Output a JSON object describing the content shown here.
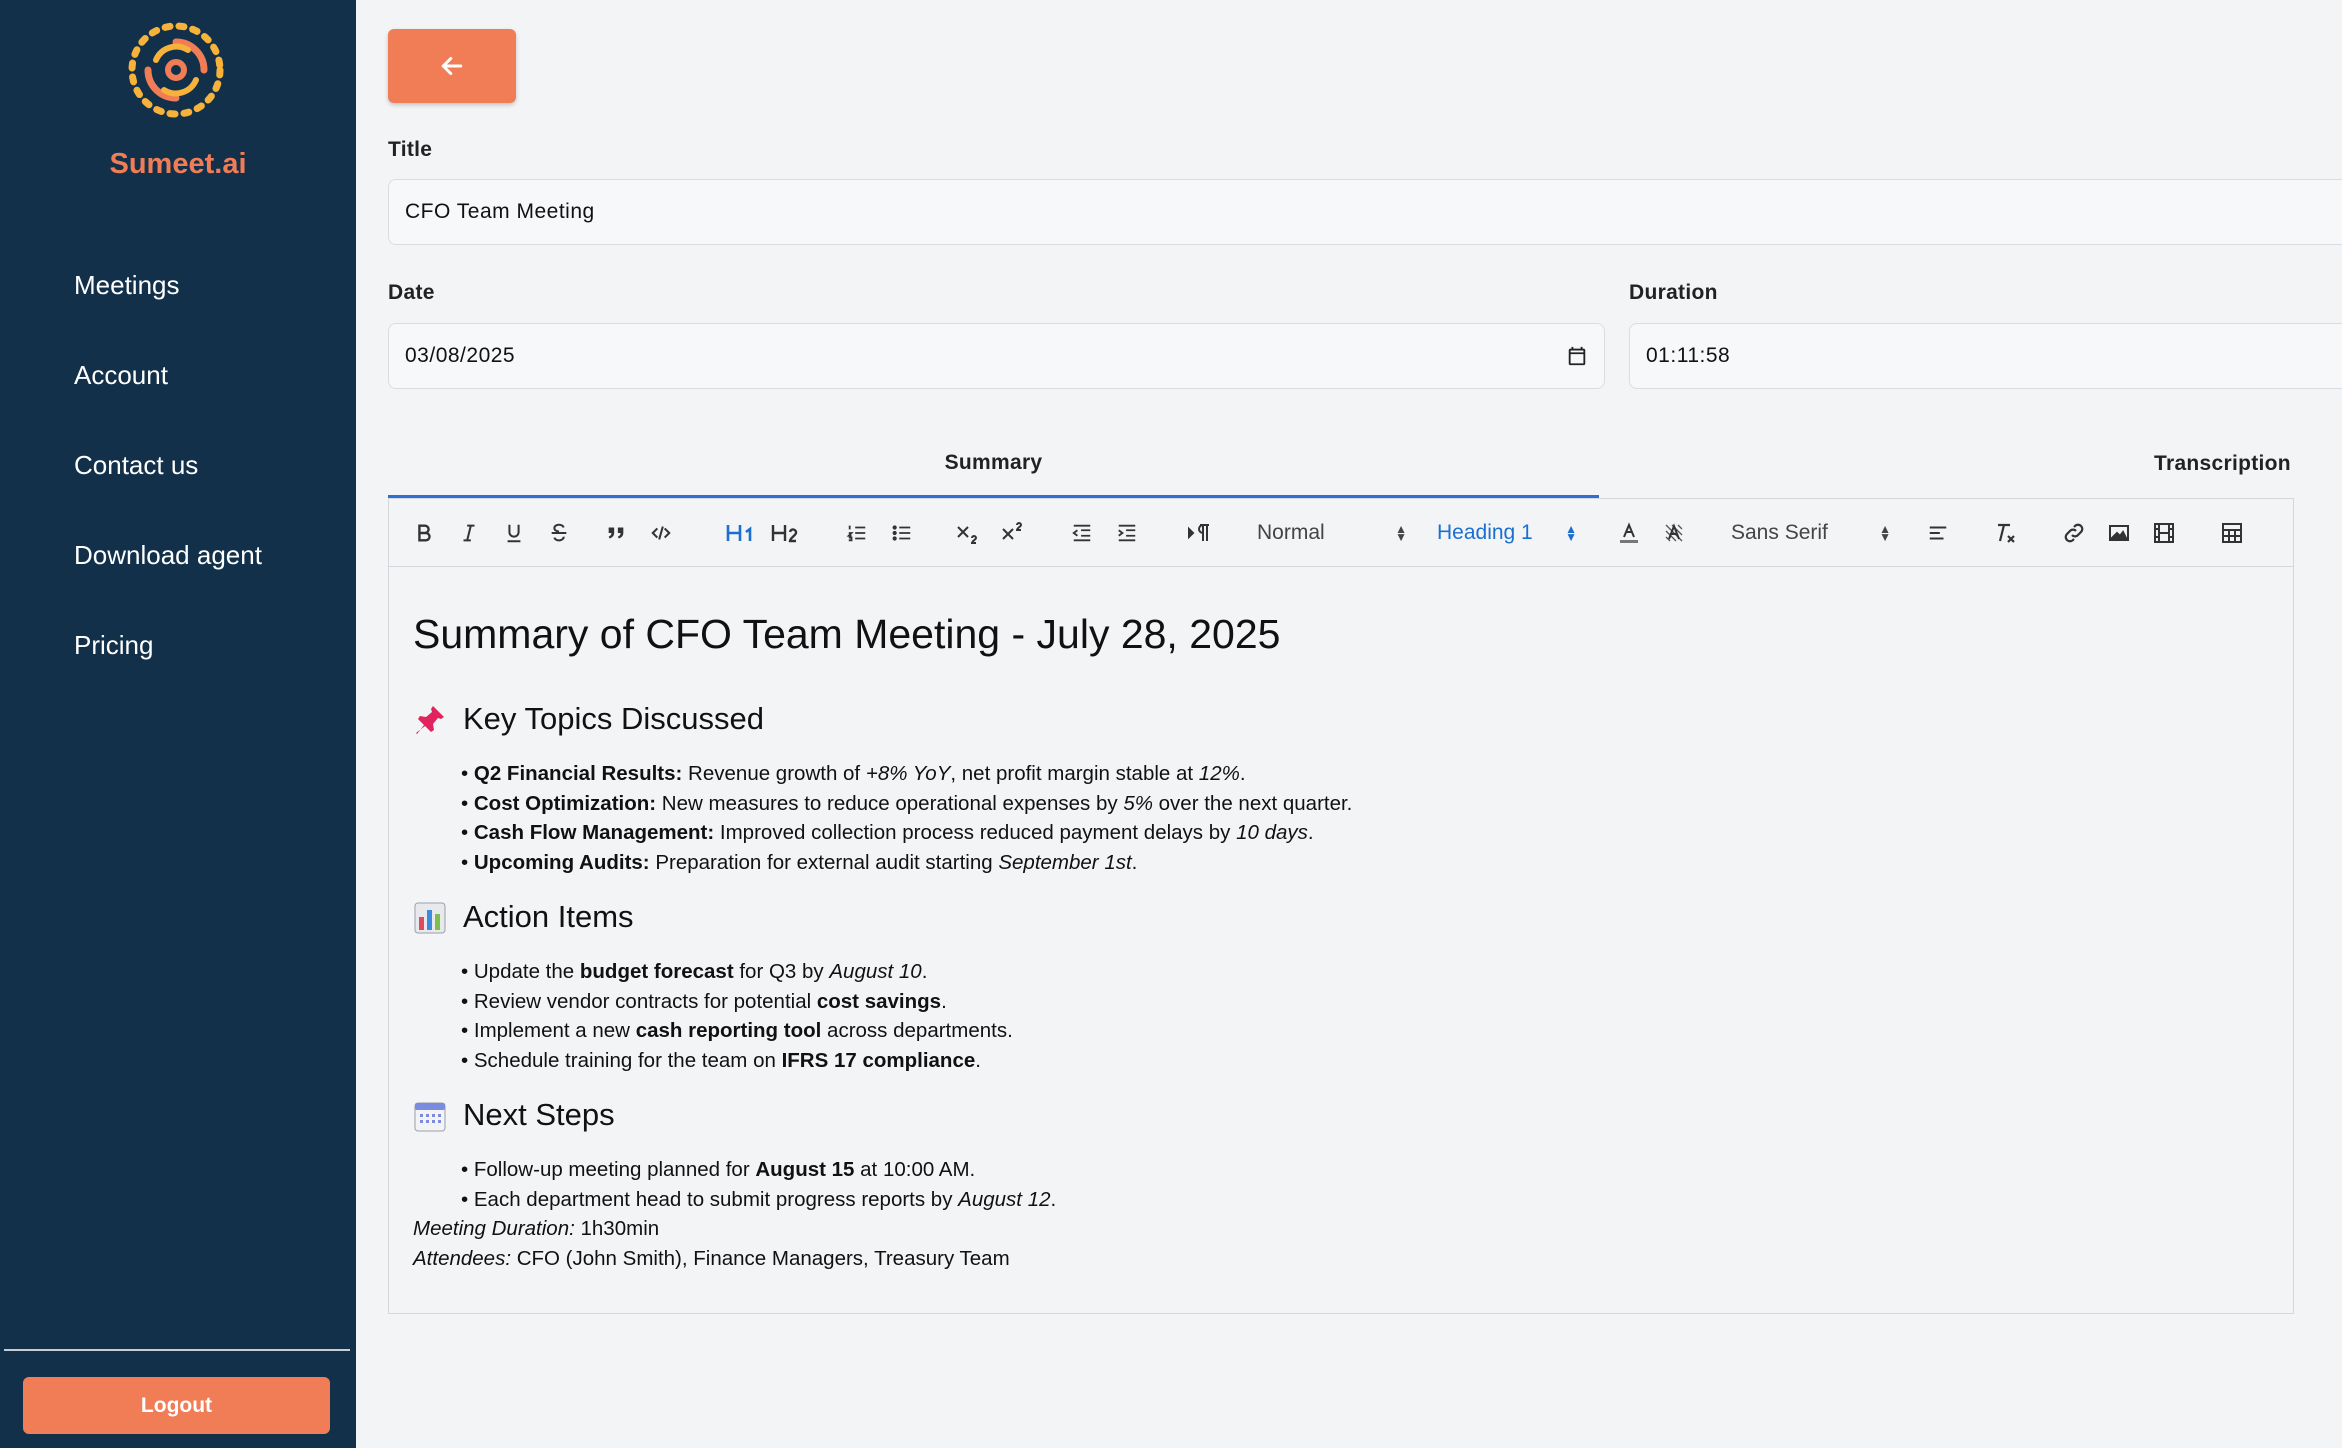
{
  "sidebar": {
    "brand": "Sumeet.ai",
    "nav": [
      "Meetings",
      "Account",
      "Contact us",
      "Download agent",
      "Pricing"
    ],
    "logout_label": "Logout"
  },
  "form": {
    "title_label": "Title",
    "title_value": "CFO Team Meeting",
    "date_label": "Date",
    "date_value": "03/08/2025",
    "duration_label": "Duration",
    "duration_value": "01:11:58"
  },
  "tabs": [
    "Summary",
    "Transcription"
  ],
  "toolbar": {
    "size_select": "Normal",
    "header_select": "Heading 1",
    "font_select": "Sans Serif"
  },
  "document": {
    "title": "Summary of CFO Team Meeting - July 28, 2025",
    "sections": [
      {
        "icon": "pushpin-icon",
        "heading": "Key Topics Discussed",
        "items": [
          [
            {
              "t": "Q2 Financial Results:",
              "s": "b"
            },
            {
              "t": " Revenue growth of "
            },
            {
              "t": "+8% YoY",
              "s": "i"
            },
            {
              "t": ", net profit margin stable at "
            },
            {
              "t": "12%",
              "s": "i"
            },
            {
              "t": "."
            }
          ],
          [
            {
              "t": "Cost Optimization:",
              "s": "b"
            },
            {
              "t": " New measures to reduce operational expenses by "
            },
            {
              "t": "5%",
              "s": "i"
            },
            {
              "t": " over the next quarter."
            }
          ],
          [
            {
              "t": "Cash Flow Management:",
              "s": "b"
            },
            {
              "t": " Improved collection process reduced payment delays by "
            },
            {
              "t": "10 days",
              "s": "i"
            },
            {
              "t": "."
            }
          ],
          [
            {
              "t": "Upcoming Audits:",
              "s": "b"
            },
            {
              "t": " Preparation for external audit starting "
            },
            {
              "t": "September 1st",
              "s": "i"
            },
            {
              "t": "."
            }
          ]
        ]
      },
      {
        "icon": "bar-chart-icon",
        "heading": "Action Items",
        "items": [
          [
            {
              "t": "Update the "
            },
            {
              "t": "budget forecast",
              "s": "b"
            },
            {
              "t": " for Q3 by "
            },
            {
              "t": "August 10",
              "s": "i"
            },
            {
              "t": "."
            }
          ],
          [
            {
              "t": "Review vendor contracts for potential "
            },
            {
              "t": "cost savings",
              "s": "b"
            },
            {
              "t": "."
            }
          ],
          [
            {
              "t": "Implement a new "
            },
            {
              "t": "cash reporting tool",
              "s": "b"
            },
            {
              "t": " across departments."
            }
          ],
          [
            {
              "t": "Schedule training for the team on "
            },
            {
              "t": "IFRS 17 compliance",
              "s": "b"
            },
            {
              "t": "."
            }
          ]
        ]
      },
      {
        "icon": "calendar-icon",
        "heading": "Next Steps",
        "items": [
          [
            {
              "t": "Follow-up meeting planned for "
            },
            {
              "t": "August 15",
              "s": "b"
            },
            {
              "t": " at 10:00 AM."
            }
          ],
          [
            {
              "t": "Each department head to submit progress reports by "
            },
            {
              "t": "August 12",
              "s": "i"
            },
            {
              "t": "."
            }
          ]
        ]
      }
    ],
    "meta": [
      {
        "label": "Meeting Duration:",
        "value": " 1h30min"
      },
      {
        "label": "Attendees:",
        "value": " CFO (John Smith), Finance Managers, Treasury Team"
      }
    ]
  },
  "colors": {
    "sidebar_bg": "#123049",
    "accent": "#f07d56",
    "tab_underline": "#2e6fd1",
    "select_blue": "#1b6fd0"
  }
}
